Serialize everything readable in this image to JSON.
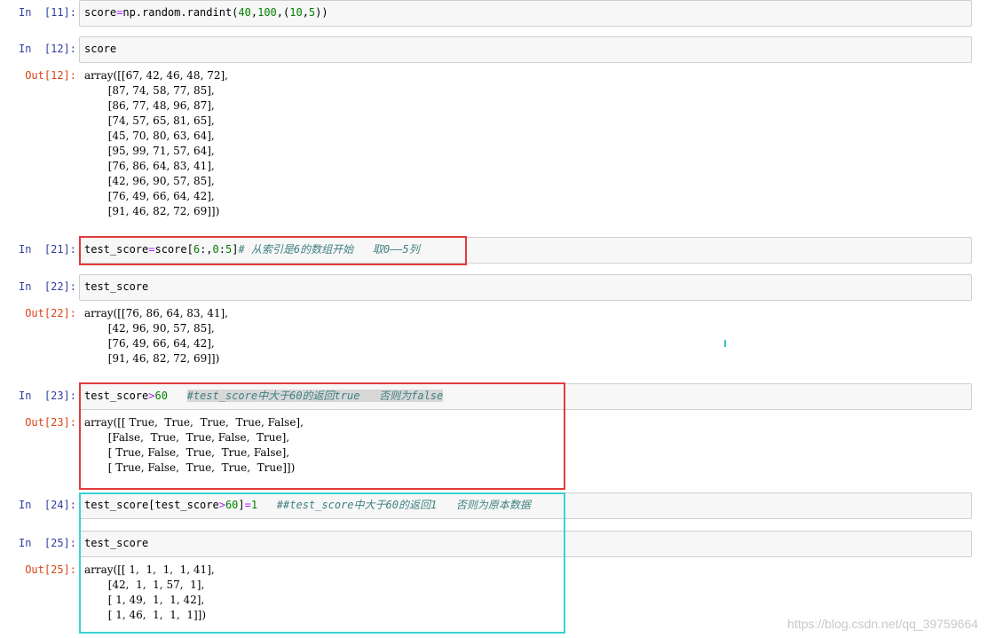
{
  "cells": [
    {
      "prompt": "In  [11]:",
      "parts": [
        "score",
        "=",
        "np.random.randint(",
        "40",
        ",",
        "100",
        ",(",
        "10",
        ",",
        "5",
        "))"
      ]
    },
    {
      "prompt": "In  [12]:",
      "code": "score",
      "out_prompt": "Out[12]:",
      "output": "array([[67, 42, 46, 48, 72],\n       [87, 74, 58, 77, 85],\n       [86, 77, 48, 96, 87],\n       [74, 57, 65, 81, 65],\n       [45, 70, 80, 63, 64],\n       [95, 99, 71, 57, 64],\n       [76, 86, 64, 83, 41],\n       [42, 96, 90, 57, 85],\n       [76, 49, 66, 64, 42],\n       [91, 46, 82, 72, 69]])"
    },
    {
      "prompt": "In  [21]:",
      "parts": [
        "test_score",
        "=",
        "score[",
        "6",
        ":,",
        "0",
        ":",
        "5",
        "]",
        "# 从索引是6的数组开始   取0——5列"
      ]
    },
    {
      "prompt": "In  [22]:",
      "code": "test_score",
      "out_prompt": "Out[22]:",
      "output": "array([[76, 86, 64, 83, 41],\n       [42, 96, 90, 57, 85],\n       [76, 49, 66, 64, 42],\n       [91, 46, 82, 72, 69]])"
    },
    {
      "prompt": "In  [23]:",
      "parts": [
        "test_score",
        ">",
        "60",
        "   ",
        "#test_score中大于60的返回true   否则为false"
      ],
      "out_prompt": "Out[23]:",
      "output": "array([[ True,  True,  True,  True, False],\n       [False,  True,  True, False,  True],\n       [ True, False,  True,  True, False],\n       [ True, False,  True,  True,  True]])"
    },
    {
      "prompt": "In  [24]:",
      "parts": [
        "test_score[test_score",
        ">",
        "60",
        "]",
        "=",
        "1",
        "   ",
        "##test_score中大于60的返回1   否则为原本数据"
      ]
    },
    {
      "prompt": "In  [25]:",
      "code": "test_score",
      "out_prompt": "Out[25]:",
      "output": "array([[ 1,  1,  1,  1, 41],\n       [42,  1,  1, 57,  1],\n       [ 1, 49,  1,  1, 42],\n       [ 1, 46,  1,  1,  1]])"
    }
  ],
  "watermark": "https://blog.csdn.net/qq_39759664",
  "colors": {
    "red_box": "#e23b3b",
    "cyan_box": "#3ad3d3",
    "in_prompt": "#303f9f",
    "out_prompt": "#d84315"
  }
}
